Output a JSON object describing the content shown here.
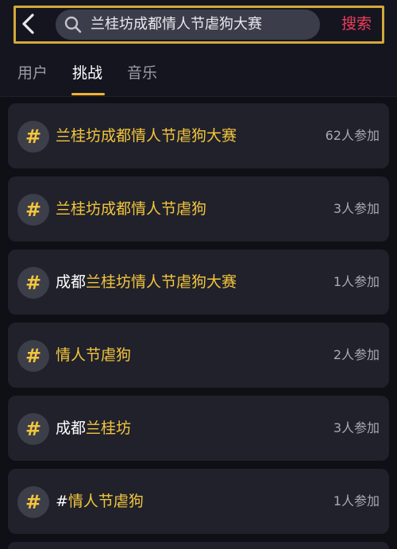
{
  "search": {
    "query": "兰桂坊成都情人节虐狗大赛",
    "button_label": "搜索"
  },
  "tabs": [
    {
      "label": "用户",
      "active": false
    },
    {
      "label": "挑战",
      "active": true
    },
    {
      "label": "音乐",
      "active": false
    }
  ],
  "hash_symbol": "#",
  "results": [
    {
      "parts": [
        {
          "text": "兰桂坊成都情人节虐狗大赛",
          "highlight": true
        }
      ],
      "count": "62人参加"
    },
    {
      "parts": [
        {
          "text": "兰桂坊成都情人节虐狗",
          "highlight": true
        }
      ],
      "count": "3人参加"
    },
    {
      "parts": [
        {
          "text": "成都",
          "highlight": false
        },
        {
          "text": "兰桂坊情人节虐狗大赛",
          "highlight": true
        }
      ],
      "count": "1人参加"
    },
    {
      "parts": [
        {
          "text": "情人节虐狗",
          "highlight": true
        }
      ],
      "count": "2人参加"
    },
    {
      "parts": [
        {
          "text": "成都",
          "highlight": false
        },
        {
          "text": "兰桂坊",
          "highlight": true
        }
      ],
      "count": "3人参加"
    },
    {
      "parts": [
        {
          "text": "#",
          "highlight": false
        },
        {
          "text": "情人节虐狗",
          "highlight": true
        }
      ],
      "count": "1人参加"
    }
  ],
  "colors": {
    "accent_gold": "#f3c53d",
    "search_red": "#ee3d5b",
    "frame_gold": "#d2a93a"
  }
}
